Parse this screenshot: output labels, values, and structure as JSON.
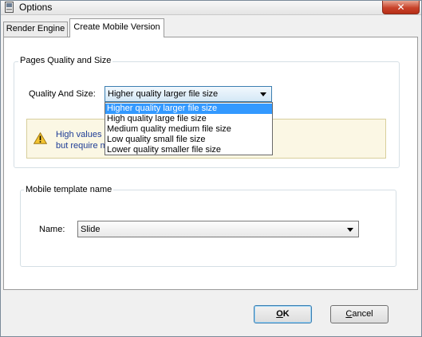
{
  "window": {
    "title": "Options",
    "close_glyph": "✕"
  },
  "tabs": [
    {
      "label": "Render Engine",
      "active": false
    },
    {
      "label": "Create Mobile Version",
      "active": true
    }
  ],
  "quality_group": {
    "legend": "Pages Quality and Size",
    "quality_label": "Quality And Size:",
    "quality_value": "Higher quality larger file size",
    "options": [
      "Higher quality larger file size",
      "High quality large file size",
      "Medium quality medium file size",
      "Low quality small file size",
      "Lower quality smaller file size"
    ],
    "selected_index": 0,
    "warning_line1": "High values p",
    "warning_line2": "but require m"
  },
  "template_group": {
    "legend": "Mobile template name",
    "name_label": "Name:",
    "name_value": "Slide"
  },
  "buttons": {
    "ok_mnemonic": "O",
    "ok_rest": "K",
    "cancel_mnemonic": "C",
    "cancel_rest": "ancel"
  },
  "colors": {
    "selection": "#3399ff",
    "warning_text": "#1e3c96",
    "warning_bg": "#fbf7e4",
    "close_button": "#c8432b"
  },
  "icons": {
    "app": "app-icon",
    "close": "close-icon",
    "warning": "warning-icon",
    "dropdown": "chevron-down-icon"
  }
}
